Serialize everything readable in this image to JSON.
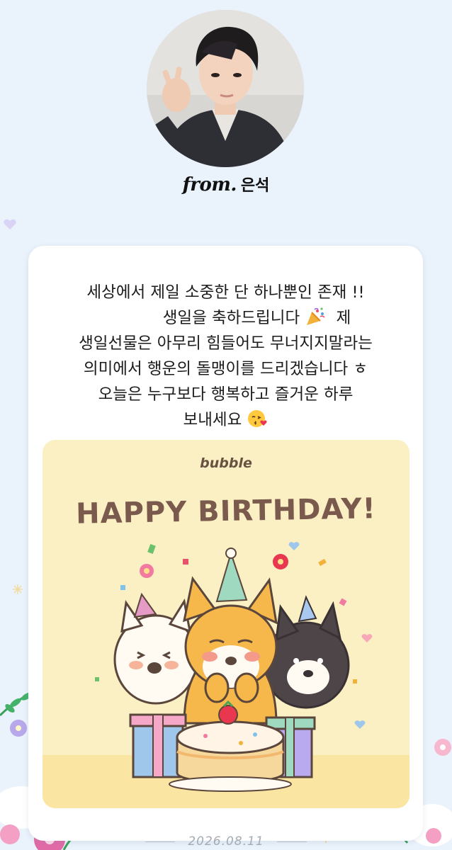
{
  "sender": {
    "prefix": "from.",
    "name": "은석"
  },
  "letter": {
    "line1": "세상에서 제일 소중한 단 하나뿐인 존재 !!",
    "line2_text": "생일을 축하드립니다",
    "line2_tail": "제",
    "line3": "생일선물은 아무리 힘들어도 무너지지말라는",
    "line4": "의미에서 행운의 돌맹이를 드리겠습니다 ㅎ",
    "line5": "오늘은 누구보다 행복하고 즐거운 하루",
    "line6": "보내세요"
  },
  "birthday_image": {
    "brand": "bubble",
    "title": "HAPPY BIRTHDAY!"
  },
  "date": "2026.08.11",
  "icons": [
    "party-popper-emoji",
    "kissing-face-emoji"
  ],
  "colors": {
    "background": "#eaf2fb",
    "card": "#ffffff",
    "birthday_bg": "#fbf0c4",
    "title_brown": "#7a5a4c"
  }
}
